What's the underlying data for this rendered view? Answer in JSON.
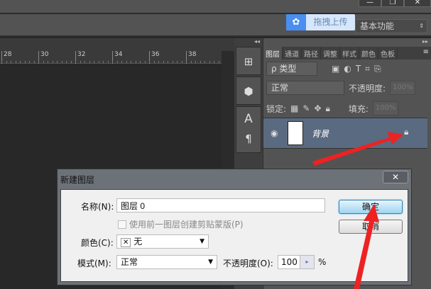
{
  "window": {
    "minimize": "—",
    "restore": "❐",
    "close": "✕"
  },
  "upload": {
    "label": "拖拽上传",
    "icon": "baidu-cloud-icon"
  },
  "workspace": {
    "value": "基本功能"
  },
  "ruler": {
    "ticks": [
      "28",
      "30",
      "32",
      "34",
      "36",
      "38"
    ]
  },
  "dock": {
    "icons": [
      "history-icon",
      "3d-icon",
      "character-icon",
      "paragraph-icon"
    ],
    "glyphs": [
      "⊞",
      "⬢",
      "A",
      "¶"
    ]
  },
  "layers_panel": {
    "tabs": [
      "图层",
      "通道",
      "路径",
      "调整",
      "样式",
      "颜色",
      "色板"
    ],
    "filter": "ρ 类型",
    "blend_mode": "正常",
    "opacity_label": "不透明度:",
    "opacity_value": "100%",
    "lock_label": "锁定:",
    "fill_label": "填充:",
    "fill_value": "100%",
    "layer_name": "背景"
  },
  "dialog": {
    "title": "新建图层",
    "close": "✕",
    "name_label": "名称(N):",
    "name_value": "图层 0",
    "clip_label": "使用前一图层创建剪贴蒙版(P)",
    "color_label": "颜色(C):",
    "color_value": "无",
    "mode_label": "模式(M):",
    "mode_value": "正常",
    "opacity_label": "不透明度(O):",
    "opacity_value": "100",
    "percent": "%",
    "ok": "确定",
    "cancel": "取消"
  },
  "colors": {
    "annotation_arrow": "#ee2222",
    "selected_layer": "#5a6a80",
    "accent_button": "#9fd5ef"
  }
}
